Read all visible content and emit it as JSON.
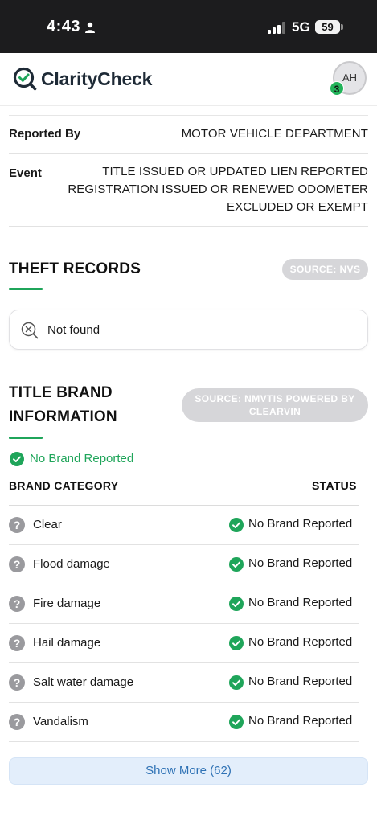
{
  "status_bar": {
    "time": "4:43",
    "network": "5G",
    "battery": "59"
  },
  "header": {
    "app_name": "ClarityCheck",
    "avatar_initials": "AH",
    "notification_count": "3",
    "brand_color": "#1fa55a"
  },
  "report": {
    "rows": [
      {
        "label": "Reported By",
        "value": "MOTOR VEHICLE DEPARTMENT"
      },
      {
        "label": "Event",
        "value_lines": [
          "TITLE ISSUED OR UPDATED LIEN REPORTED",
          "REGISTRATION ISSUED OR RENEWED ODOMETER",
          "EXCLUDED OR EXEMPT"
        ]
      }
    ]
  },
  "theft": {
    "title": "THEFT RECORDS",
    "source": "SOURCE: NVS",
    "result": "Not found"
  },
  "title_brand": {
    "title_lines": [
      "TITLE BRAND",
      "INFORMATION"
    ],
    "source_lines": [
      "SOURCE: NMVTIS POWERED BY",
      "CLEARVIN"
    ],
    "summary": "No Brand Reported",
    "col_category": "BRAND CATEGORY",
    "col_status": "STATUS",
    "rows": [
      {
        "category": "Clear",
        "status": "No Brand Reported"
      },
      {
        "category": "Flood damage",
        "status": "No Brand Reported"
      },
      {
        "category": "Fire damage",
        "status": "No Brand Reported"
      },
      {
        "category": "Hail damage",
        "status": "No Brand Reported"
      },
      {
        "category": "Salt water damage",
        "status": "No Brand Reported"
      },
      {
        "category": "Vandalism",
        "status": "No Brand Reported"
      }
    ],
    "show_more": "Show More (62)"
  },
  "icons": {
    "logo": "clarity-check-logo-icon",
    "not_found": "magnifier-x-icon",
    "help": "question-circle-icon",
    "ok": "check-circle-icon"
  }
}
